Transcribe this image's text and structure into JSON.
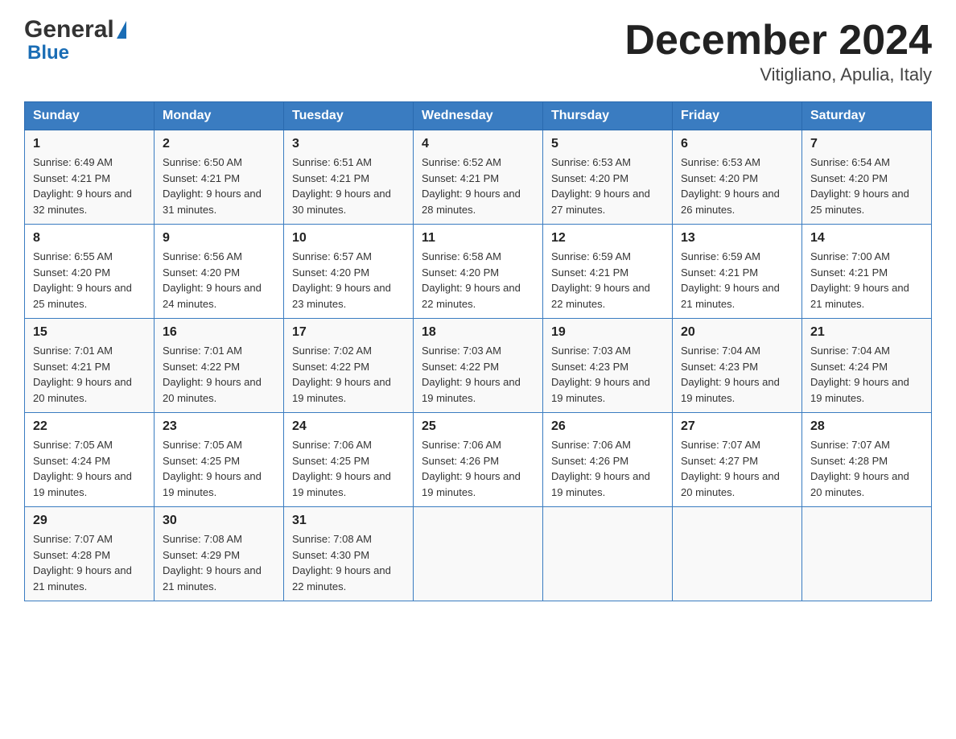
{
  "logo": {
    "general": "General",
    "blue": "Blue"
  },
  "title": "December 2024",
  "subtitle": "Vitigliano, Apulia, Italy",
  "days": [
    "Sunday",
    "Monday",
    "Tuesday",
    "Wednesday",
    "Thursday",
    "Friday",
    "Saturday"
  ],
  "weeks": [
    [
      {
        "num": "1",
        "sunrise": "Sunrise: 6:49 AM",
        "sunset": "Sunset: 4:21 PM",
        "daylight": "Daylight: 9 hours and 32 minutes."
      },
      {
        "num": "2",
        "sunrise": "Sunrise: 6:50 AM",
        "sunset": "Sunset: 4:21 PM",
        "daylight": "Daylight: 9 hours and 31 minutes."
      },
      {
        "num": "3",
        "sunrise": "Sunrise: 6:51 AM",
        "sunset": "Sunset: 4:21 PM",
        "daylight": "Daylight: 9 hours and 30 minutes."
      },
      {
        "num": "4",
        "sunrise": "Sunrise: 6:52 AM",
        "sunset": "Sunset: 4:21 PM",
        "daylight": "Daylight: 9 hours and 28 minutes."
      },
      {
        "num": "5",
        "sunrise": "Sunrise: 6:53 AM",
        "sunset": "Sunset: 4:20 PM",
        "daylight": "Daylight: 9 hours and 27 minutes."
      },
      {
        "num": "6",
        "sunrise": "Sunrise: 6:53 AM",
        "sunset": "Sunset: 4:20 PM",
        "daylight": "Daylight: 9 hours and 26 minutes."
      },
      {
        "num": "7",
        "sunrise": "Sunrise: 6:54 AM",
        "sunset": "Sunset: 4:20 PM",
        "daylight": "Daylight: 9 hours and 25 minutes."
      }
    ],
    [
      {
        "num": "8",
        "sunrise": "Sunrise: 6:55 AM",
        "sunset": "Sunset: 4:20 PM",
        "daylight": "Daylight: 9 hours and 25 minutes."
      },
      {
        "num": "9",
        "sunrise": "Sunrise: 6:56 AM",
        "sunset": "Sunset: 4:20 PM",
        "daylight": "Daylight: 9 hours and 24 minutes."
      },
      {
        "num": "10",
        "sunrise": "Sunrise: 6:57 AM",
        "sunset": "Sunset: 4:20 PM",
        "daylight": "Daylight: 9 hours and 23 minutes."
      },
      {
        "num": "11",
        "sunrise": "Sunrise: 6:58 AM",
        "sunset": "Sunset: 4:20 PM",
        "daylight": "Daylight: 9 hours and 22 minutes."
      },
      {
        "num": "12",
        "sunrise": "Sunrise: 6:59 AM",
        "sunset": "Sunset: 4:21 PM",
        "daylight": "Daylight: 9 hours and 22 minutes."
      },
      {
        "num": "13",
        "sunrise": "Sunrise: 6:59 AM",
        "sunset": "Sunset: 4:21 PM",
        "daylight": "Daylight: 9 hours and 21 minutes."
      },
      {
        "num": "14",
        "sunrise": "Sunrise: 7:00 AM",
        "sunset": "Sunset: 4:21 PM",
        "daylight": "Daylight: 9 hours and 21 minutes."
      }
    ],
    [
      {
        "num": "15",
        "sunrise": "Sunrise: 7:01 AM",
        "sunset": "Sunset: 4:21 PM",
        "daylight": "Daylight: 9 hours and 20 minutes."
      },
      {
        "num": "16",
        "sunrise": "Sunrise: 7:01 AM",
        "sunset": "Sunset: 4:22 PM",
        "daylight": "Daylight: 9 hours and 20 minutes."
      },
      {
        "num": "17",
        "sunrise": "Sunrise: 7:02 AM",
        "sunset": "Sunset: 4:22 PM",
        "daylight": "Daylight: 9 hours and 19 minutes."
      },
      {
        "num": "18",
        "sunrise": "Sunrise: 7:03 AM",
        "sunset": "Sunset: 4:22 PM",
        "daylight": "Daylight: 9 hours and 19 minutes."
      },
      {
        "num": "19",
        "sunrise": "Sunrise: 7:03 AM",
        "sunset": "Sunset: 4:23 PM",
        "daylight": "Daylight: 9 hours and 19 minutes."
      },
      {
        "num": "20",
        "sunrise": "Sunrise: 7:04 AM",
        "sunset": "Sunset: 4:23 PM",
        "daylight": "Daylight: 9 hours and 19 minutes."
      },
      {
        "num": "21",
        "sunrise": "Sunrise: 7:04 AM",
        "sunset": "Sunset: 4:24 PM",
        "daylight": "Daylight: 9 hours and 19 minutes."
      }
    ],
    [
      {
        "num": "22",
        "sunrise": "Sunrise: 7:05 AM",
        "sunset": "Sunset: 4:24 PM",
        "daylight": "Daylight: 9 hours and 19 minutes."
      },
      {
        "num": "23",
        "sunrise": "Sunrise: 7:05 AM",
        "sunset": "Sunset: 4:25 PM",
        "daylight": "Daylight: 9 hours and 19 minutes."
      },
      {
        "num": "24",
        "sunrise": "Sunrise: 7:06 AM",
        "sunset": "Sunset: 4:25 PM",
        "daylight": "Daylight: 9 hours and 19 minutes."
      },
      {
        "num": "25",
        "sunrise": "Sunrise: 7:06 AM",
        "sunset": "Sunset: 4:26 PM",
        "daylight": "Daylight: 9 hours and 19 minutes."
      },
      {
        "num": "26",
        "sunrise": "Sunrise: 7:06 AM",
        "sunset": "Sunset: 4:26 PM",
        "daylight": "Daylight: 9 hours and 19 minutes."
      },
      {
        "num": "27",
        "sunrise": "Sunrise: 7:07 AM",
        "sunset": "Sunset: 4:27 PM",
        "daylight": "Daylight: 9 hours and 20 minutes."
      },
      {
        "num": "28",
        "sunrise": "Sunrise: 7:07 AM",
        "sunset": "Sunset: 4:28 PM",
        "daylight": "Daylight: 9 hours and 20 minutes."
      }
    ],
    [
      {
        "num": "29",
        "sunrise": "Sunrise: 7:07 AM",
        "sunset": "Sunset: 4:28 PM",
        "daylight": "Daylight: 9 hours and 21 minutes."
      },
      {
        "num": "30",
        "sunrise": "Sunrise: 7:08 AM",
        "sunset": "Sunset: 4:29 PM",
        "daylight": "Daylight: 9 hours and 21 minutes."
      },
      {
        "num": "31",
        "sunrise": "Sunrise: 7:08 AM",
        "sunset": "Sunset: 4:30 PM",
        "daylight": "Daylight: 9 hours and 22 minutes."
      },
      null,
      null,
      null,
      null
    ]
  ]
}
